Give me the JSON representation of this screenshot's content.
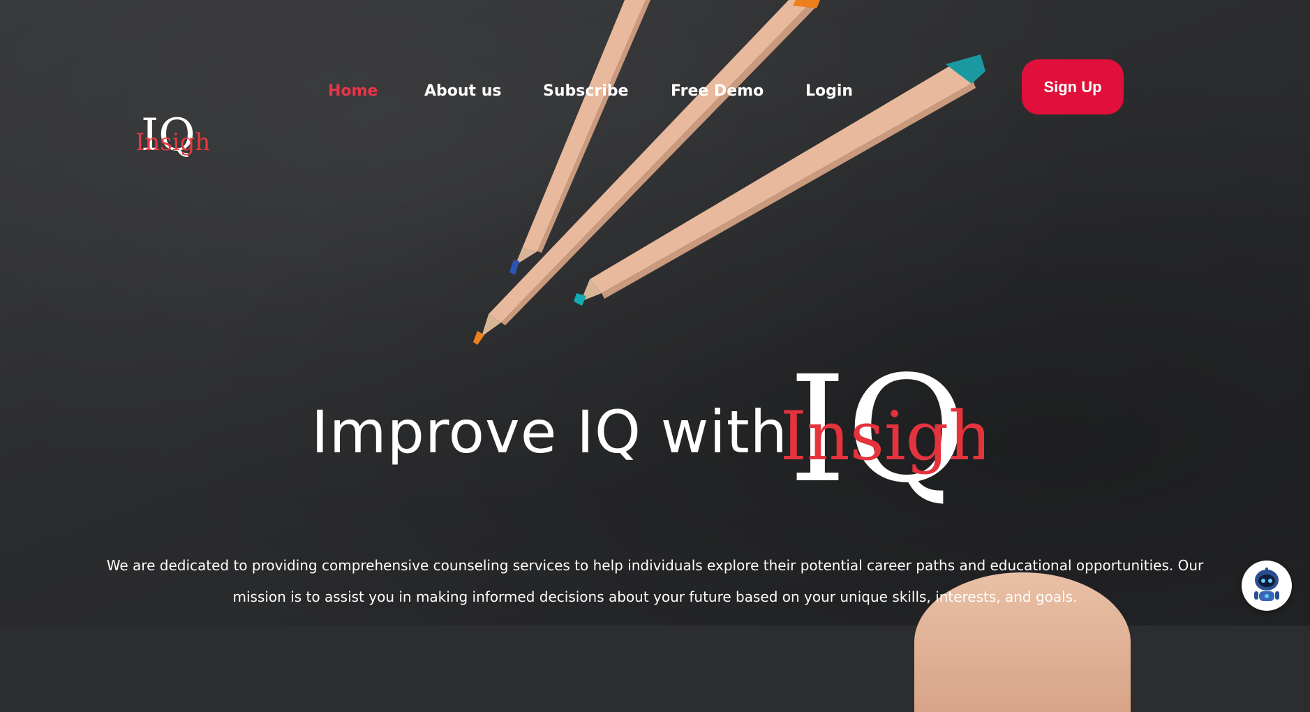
{
  "nav": {
    "items": [
      {
        "label": "Home",
        "active": true
      },
      {
        "label": "About us",
        "active": false
      },
      {
        "label": "Subscribe",
        "active": false
      },
      {
        "label": "Free Demo",
        "active": false
      },
      {
        "label": "Login",
        "active": false
      }
    ],
    "signup_label": "Sign Up"
  },
  "brand": {
    "logo_letters": "IQ",
    "logo_word": "Insight",
    "accent_color": "#e0103a",
    "active_nav_color": "#e8344a"
  },
  "hero": {
    "headline": "Improve IQ with",
    "description": "We are dedicated to providing comprehensive counseling services to help individuals explore their potential career paths and educational opportunities. Our mission is to assist you in making informed decisions about your future based on your unique skills, interests, and goals."
  },
  "chat": {
    "icon": "robot-icon"
  }
}
